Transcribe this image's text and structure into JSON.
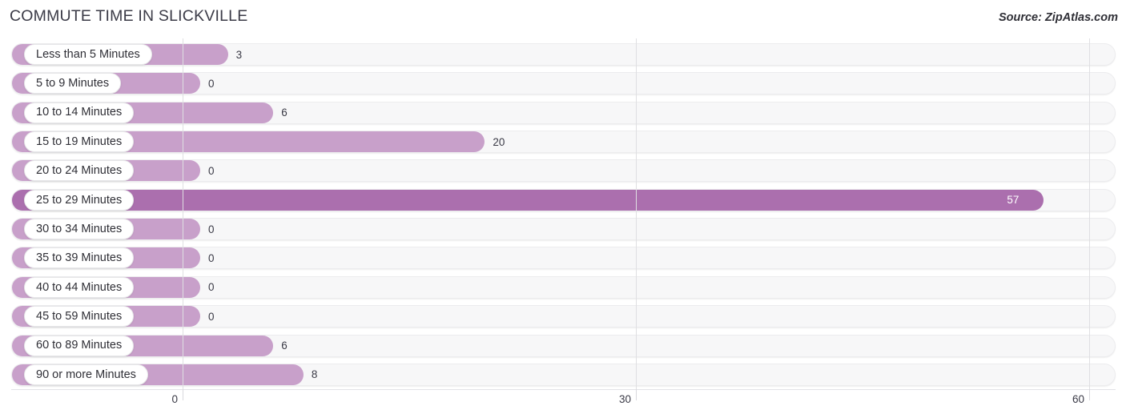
{
  "header": {
    "title": "COMMUTE TIME IN SLICKVILLE",
    "source": "Source: ZipAtlas.com"
  },
  "colors": {
    "bar_light": "#c8a0ca",
    "bar_dark": "#ab6fae",
    "track": "#f7f7f8",
    "grid": "#dfdfe2",
    "text": "#2f2f36"
  },
  "chart_data": {
    "type": "bar",
    "orientation": "horizontal",
    "title": "COMMUTE TIME IN SLICKVILLE",
    "subtitle": "",
    "xlabel": "",
    "ylabel": "",
    "xlim": [
      0,
      60
    ],
    "xticks": [
      "0",
      "30",
      "60"
    ],
    "xtick_values": [
      0,
      30,
      60
    ],
    "grid": true,
    "legend": false,
    "categories": [
      "Less than 5 Minutes",
      "5 to 9 Minutes",
      "10 to 14 Minutes",
      "15 to 19 Minutes",
      "20 to 24 Minutes",
      "25 to 29 Minutes",
      "30 to 34 Minutes",
      "35 to 39 Minutes",
      "40 to 44 Minutes",
      "45 to 59 Minutes",
      "60 to 89 Minutes",
      "90 or more Minutes"
    ],
    "values": [
      3,
      0,
      6,
      20,
      0,
      57,
      0,
      0,
      0,
      0,
      6,
      8
    ],
    "value_labels": [
      "3",
      "0",
      "6",
      "20",
      "0",
      "57",
      "0",
      "0",
      "0",
      "0",
      "6",
      "8"
    ],
    "rows": [
      {
        "label": "Less than 5 Minutes",
        "value": 3,
        "value_label": "3",
        "highlight": false
      },
      {
        "label": "5 to 9 Minutes",
        "value": 0,
        "value_label": "0",
        "highlight": false
      },
      {
        "label": "10 to 14 Minutes",
        "value": 6,
        "value_label": "6",
        "highlight": false
      },
      {
        "label": "15 to 19 Minutes",
        "value": 20,
        "value_label": "20",
        "highlight": false
      },
      {
        "label": "20 to 24 Minutes",
        "value": 0,
        "value_label": "0",
        "highlight": false
      },
      {
        "label": "25 to 29 Minutes",
        "value": 57,
        "value_label": "57",
        "highlight": true
      },
      {
        "label": "30 to 34 Minutes",
        "value": 0,
        "value_label": "0",
        "highlight": false
      },
      {
        "label": "35 to 39 Minutes",
        "value": 0,
        "value_label": "0",
        "highlight": false
      },
      {
        "label": "40 to 44 Minutes",
        "value": 0,
        "value_label": "0",
        "highlight": false
      },
      {
        "label": "45 to 59 Minutes",
        "value": 0,
        "value_label": "0",
        "highlight": false
      },
      {
        "label": "60 to 89 Minutes",
        "value": 6,
        "value_label": "6",
        "highlight": false
      },
      {
        "label": "90 or more Minutes",
        "value": 8,
        "value_label": "8",
        "highlight": false
      }
    ]
  }
}
